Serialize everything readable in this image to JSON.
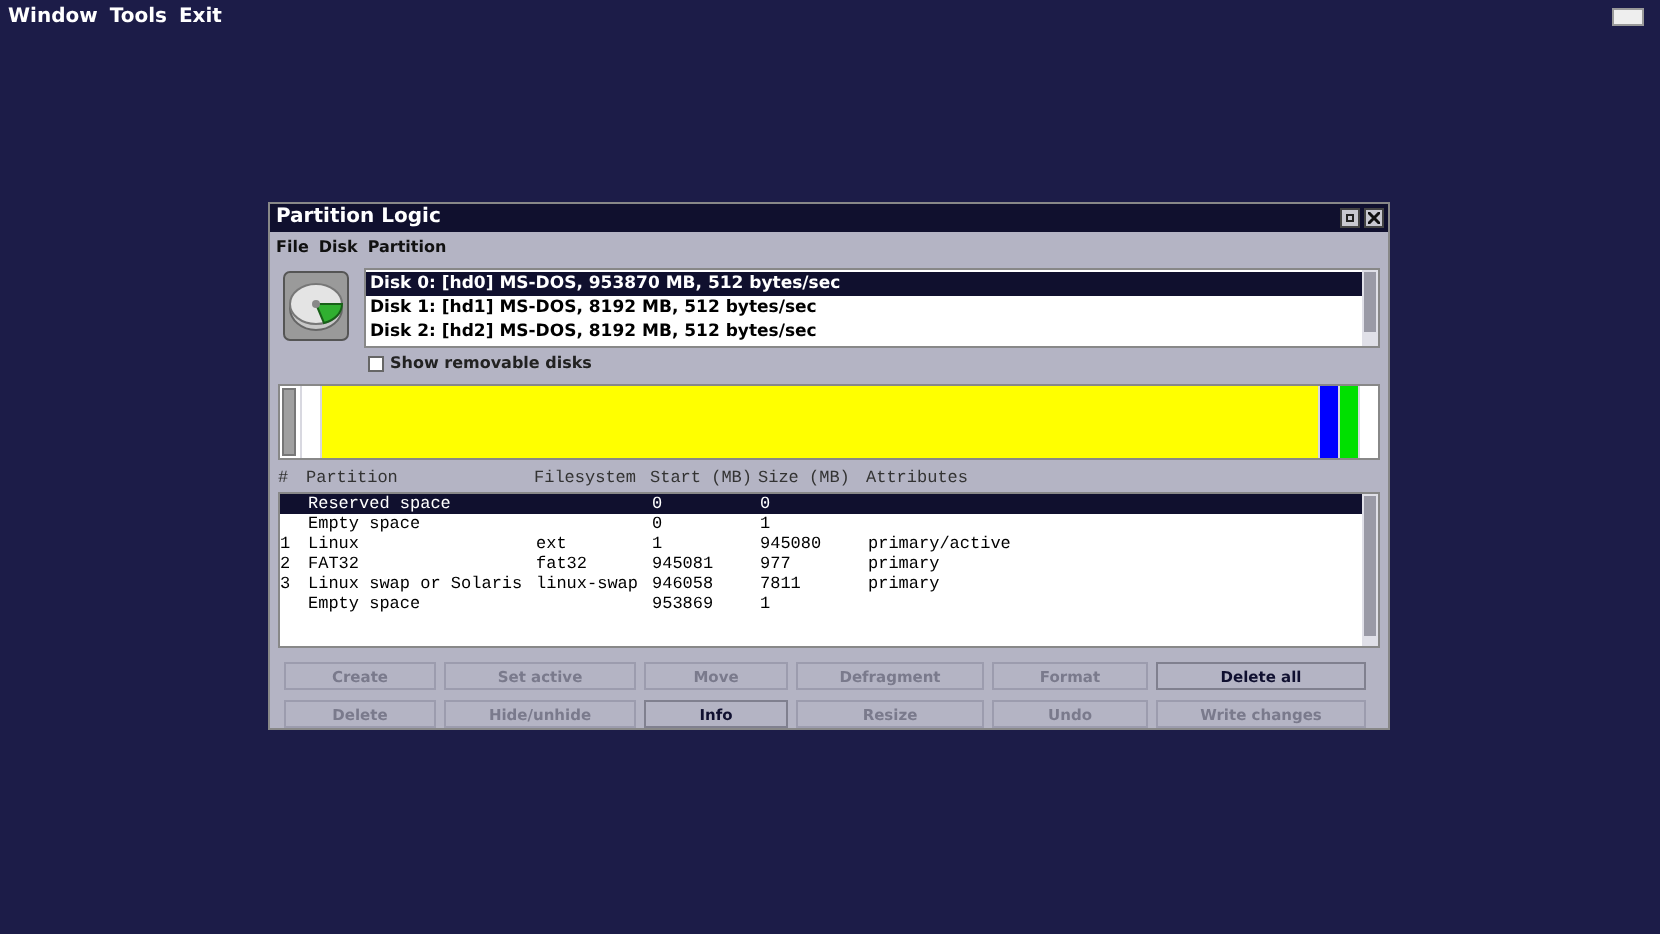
{
  "menubar": [
    "Window",
    "Tools",
    "Exit"
  ],
  "window": {
    "title": "Partition Logic",
    "menu": [
      "File",
      "Disk",
      "Partition"
    ],
    "disks": [
      {
        "label": "Disk 0: [hd0] MS-DOS, 953870 MB, 512 bytes/sec",
        "selected": true
      },
      {
        "label": "Disk 1: [hd1] MS-DOS, 8192 MB, 512 bytes/sec",
        "selected": false
      },
      {
        "label": "Disk 2: [hd2] MS-DOS, 8192 MB, 512 bytes/sec",
        "selected": false
      }
    ],
    "show_removable": {
      "label": "Show removable disks",
      "checked": false
    },
    "table": {
      "columns": [
        "#",
        "Partition",
        "Filesystem",
        "Start (MB)",
        "Size (MB)",
        "Attributes"
      ],
      "rows": [
        {
          "cells": [
            "",
            "Reserved space",
            "",
            "0",
            "0",
            ""
          ],
          "color": "#a0a0a0",
          "selected": true
        },
        {
          "cells": [
            "",
            "Empty space",
            "",
            "0",
            "1",
            ""
          ],
          "color": "#ffffff",
          "selected": false
        },
        {
          "cells": [
            "1",
            "Linux",
            "ext",
            "1",
            "945080",
            "primary/active"
          ],
          "color": "#ffff00",
          "selected": false
        },
        {
          "cells": [
            "2",
            "FAT32",
            "fat32",
            "945081",
            "977",
            "primary"
          ],
          "color": "#0000ff",
          "selected": false
        },
        {
          "cells": [
            "3",
            "Linux swap or Solaris",
            "linux-swap",
            "946058",
            "7811",
            "primary"
          ],
          "color": "#00e000",
          "selected": false
        },
        {
          "cells": [
            "",
            "Empty space",
            "",
            "953869",
            "1",
            ""
          ],
          "color": "#ffffff",
          "selected": false
        }
      ]
    },
    "buttons": [
      {
        "label": "Create",
        "disabled": true
      },
      {
        "label": "Set active",
        "disabled": true
      },
      {
        "label": "Move",
        "disabled": true
      },
      {
        "label": "Defragment",
        "disabled": true
      },
      {
        "label": "Format",
        "disabled": true
      },
      {
        "label": "Delete all",
        "disabled": false
      },
      {
        "label": "Delete",
        "disabled": true
      },
      {
        "label": "Hide/unhide",
        "disabled": true
      },
      {
        "label": "Info",
        "disabled": false
      },
      {
        "label": "Resize",
        "disabled": true
      },
      {
        "label": "Undo",
        "disabled": true
      },
      {
        "label": "Write changes",
        "disabled": true
      }
    ]
  }
}
